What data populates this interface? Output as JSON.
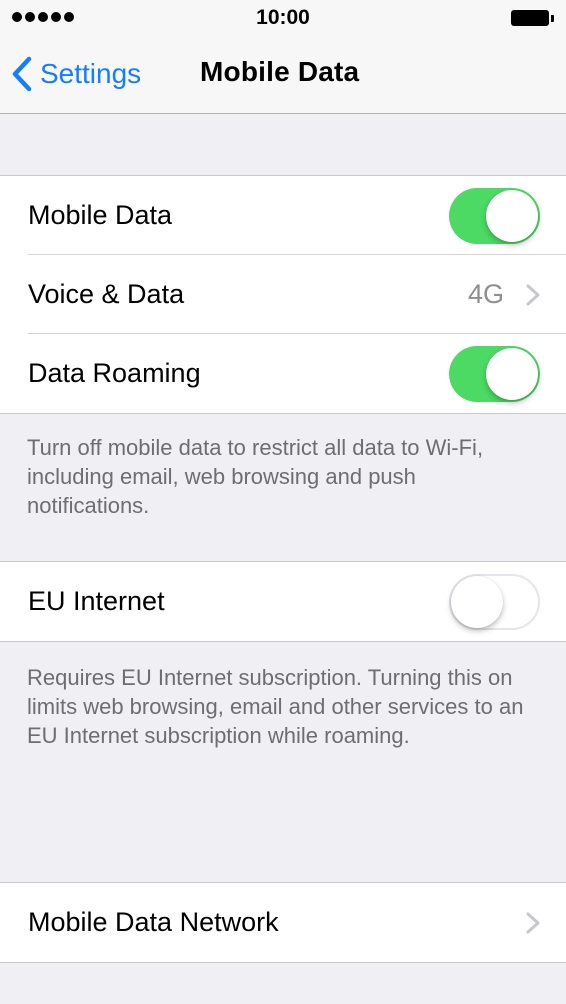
{
  "status_bar": {
    "time": "10:00",
    "signal_bars": 5
  },
  "nav": {
    "back_label": "Settings",
    "title": "Mobile Data"
  },
  "section1": {
    "rows": [
      {
        "label": "Mobile Data",
        "toggle": "on"
      },
      {
        "label": "Voice & Data",
        "value": "4G"
      },
      {
        "label": "Data Roaming",
        "toggle": "on"
      }
    ],
    "footer": "Turn off mobile data to restrict all data to Wi-Fi, including email, web browsing and push notifications."
  },
  "section2": {
    "rows": [
      {
        "label": "EU Internet",
        "toggle": "off"
      }
    ],
    "footer": "Requires EU Internet subscription. Turning this on limits web browsing, email and other services to an EU Internet subscription while roaming."
  },
  "section3": {
    "rows": [
      {
        "label": "Mobile Data Network"
      }
    ]
  },
  "colors": {
    "accent": "#147efb",
    "toggle_on": "#4cd964",
    "background": "#efeff4",
    "secondary_text": "#8e8e93"
  }
}
